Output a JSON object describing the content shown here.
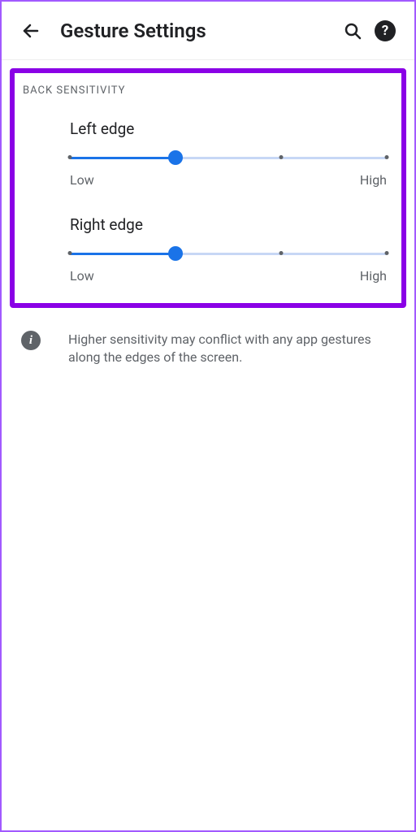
{
  "header": {
    "title": "Gesture Settings"
  },
  "section": {
    "label": "Back Sensitivity"
  },
  "sliders": {
    "left": {
      "title": "Left edge",
      "lowLabel": "Low",
      "highLabel": "High",
      "value": 1,
      "max": 3
    },
    "right": {
      "title": "Right edge",
      "lowLabel": "Low",
      "highLabel": "High",
      "value": 1,
      "max": 3
    }
  },
  "info": {
    "text": "Higher sensitivity may conflict with any app gestures along the edges of the screen."
  }
}
